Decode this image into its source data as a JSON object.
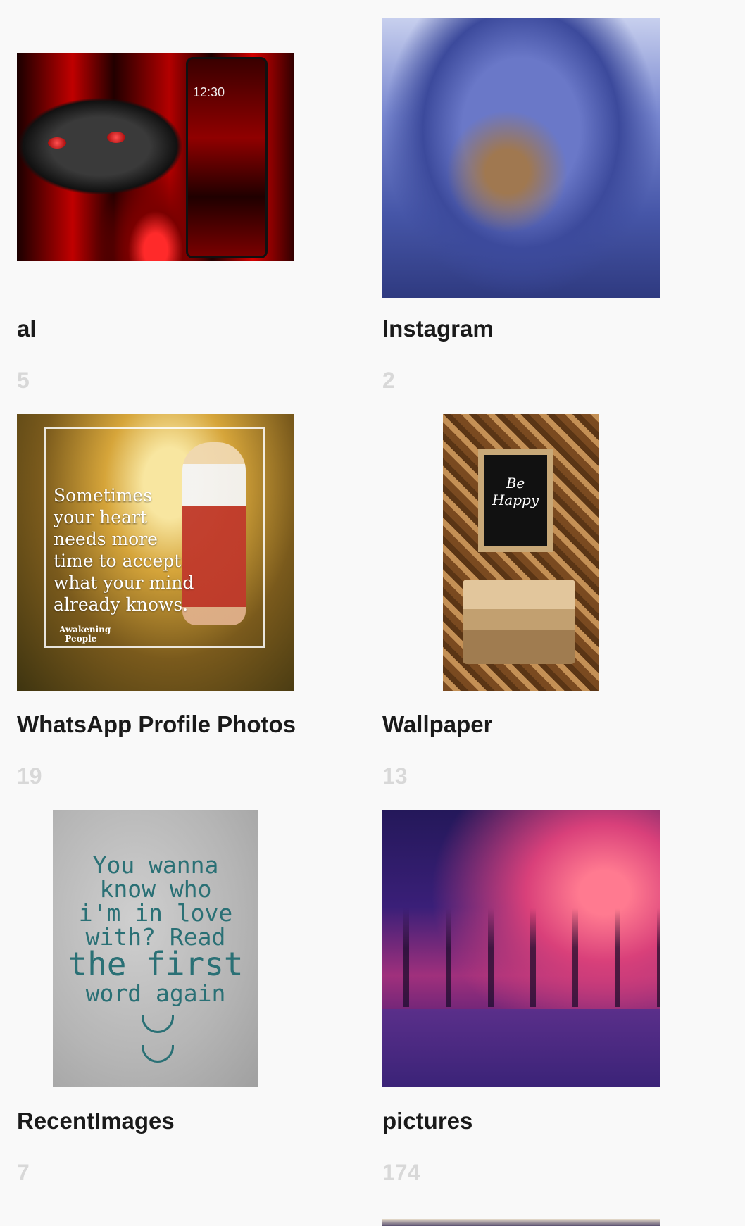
{
  "albums": [
    {
      "name": "al",
      "count": "5",
      "thumbnail": "skull-theme-image"
    },
    {
      "name": "Instagram",
      "count": "2",
      "thumbnail": "blurred-blue-image"
    },
    {
      "name": "WhatsApp Profile Photos",
      "count": "19",
      "thumbnail": "quote-image",
      "thumb_text": "Sometimes\nyour heart\nneeds more\ntime to accept\nwhat your mind\nalready knows.",
      "thumb_brand": "Awakening\n  People"
    },
    {
      "name": "Wallpaper",
      "count": "13",
      "thumbnail": "be-happy-image",
      "thumb_text": "Be\nHappy"
    },
    {
      "name": "RecentImages",
      "count": "7",
      "thumbnail": "love-quote-image",
      "thumb_text": "You wanna\nknow who\ni'm in love\nwith? Read",
      "thumb_text_big": "the first",
      "thumb_text_small": "word again"
    },
    {
      "name": "pictures",
      "count": "174",
      "thumbnail": "winter-sunset-image"
    }
  ],
  "skull_thumb_time": "12:30"
}
